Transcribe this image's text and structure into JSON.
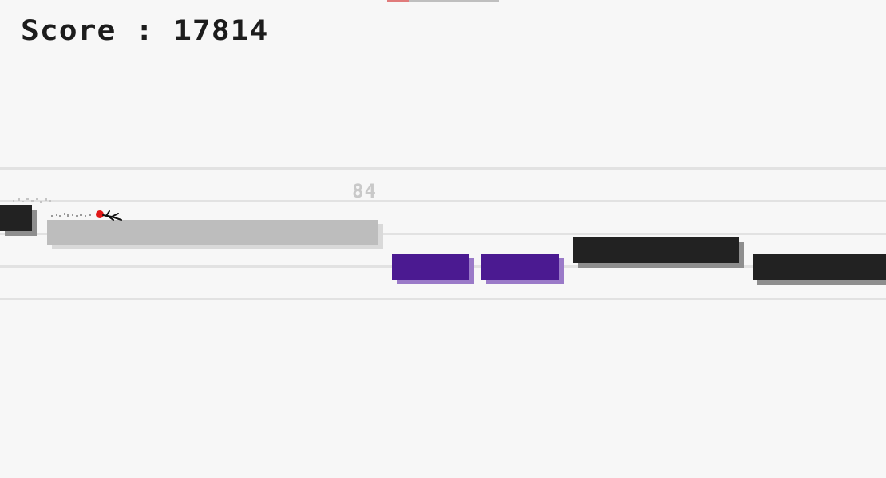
{
  "hud": {
    "score_label": "Score : 17814",
    "lane_number": "84",
    "progress_fraction": 0.2
  },
  "colors": {
    "background": "#f7f7f7",
    "lane_line": "#e2e2e2",
    "gray_block": "#bdbdbd",
    "dark_block": "#222222",
    "purple_block": "#4b1a91",
    "player_head": "#e01818"
  },
  "icons": {
    "player": "stick-figure-runner-icon",
    "trail": "particle-trail-icon"
  }
}
